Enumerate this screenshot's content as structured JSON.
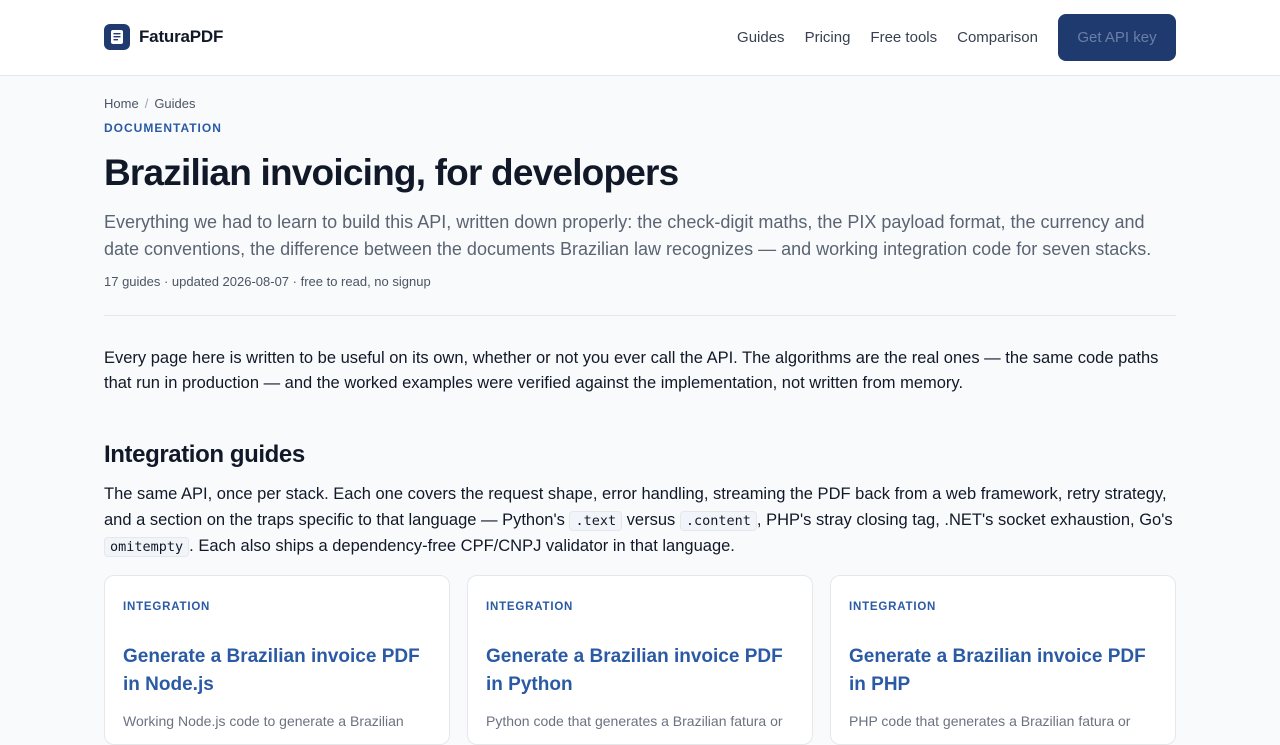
{
  "header": {
    "brand": "FaturaPDF",
    "nav": [
      "Guides",
      "Pricing",
      "Free tools",
      "Comparison"
    ],
    "cta": "Get API key"
  },
  "breadcrumb": [
    "Home",
    "Guides"
  ],
  "eyebrow": "DOCUMENTATION",
  "title": "Brazilian invoicing, for developers",
  "lede": "Everything we had to learn to build this API, written down properly: the check-digit maths, the PIX payload format, the currency and date conventions, the difference between the documents Brazilian law recognizes — and working integration code for seven stacks.",
  "meta": "17 guides · updated 2026-08-07 · free to read, no signup",
  "intro": "Every page here is written to be useful on its own, whether or not you ever call the API. The algorithms are the real ones — the same code paths that run in production — and the worked examples were verified against the implementation, not written from memory.",
  "section": {
    "heading": "Integration guides",
    "desc": {
      "p1": "The same API, once per stack. Each one covers the request shape, error handling, streaming the PDF back from a web framework, retry strategy, and a section on the traps specific to that language — Python's ",
      "code1": ".text",
      "p2": " versus ",
      "code2": ".content",
      "p3": ", PHP's stray closing tag, .NET's socket exhaustion, Go's ",
      "code3": "omitempty",
      "p4": ". Each also ships a dependency-free CPF/CNPJ validator in that language."
    },
    "cards": [
      {
        "tag": "INTEGRATION",
        "title": "Generate a Brazilian invoice PDF in Node.js",
        "desc": "Working Node.js code to generate a Brazilian"
      },
      {
        "tag": "INTEGRATION",
        "title": "Generate a Brazilian invoice PDF in Python",
        "desc": "Python code that generates a Brazilian fatura or"
      },
      {
        "tag": "INTEGRATION",
        "title": "Generate a Brazilian invoice PDF in PHP",
        "desc": "PHP code that generates a Brazilian fatura or"
      }
    ]
  },
  "colors": {
    "accent": "#2b5aa5",
    "brand": "#1e3a6e",
    "background": "#f8fafc"
  }
}
